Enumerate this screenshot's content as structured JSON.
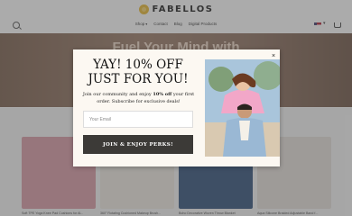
{
  "header": {
    "brand": "FABELLOS",
    "nav": [
      {
        "label": "Shop",
        "has_caret": true
      },
      {
        "label": "Contact",
        "has_caret": false
      },
      {
        "label": "Blog",
        "has_caret": false
      },
      {
        "label": "Digital Products",
        "has_caret": false
      }
    ]
  },
  "hero": {
    "title": "Fuel Your Mind with"
  },
  "products": [
    {
      "title": "Soft TPE Yoga Knee Pad Cushions for Al...",
      "color": "#d99aa6"
    },
    {
      "title": "360° Rotating Cushioned Makeup Brush...",
      "color": "#efeae3"
    },
    {
      "title": "Boho Decorative Woven Throw Blanket",
      "color": "#2f4f7a"
    },
    {
      "title": "Aqua Silicone Braided Adjustable Band f...",
      "color": "#e7e1da"
    }
  ],
  "popup": {
    "title_line1": "YAY! 10% OFF",
    "title_line2": "JUST FOR YOU!",
    "subtitle_before": "Join our community and enjoy ",
    "subtitle_bold": "10% off",
    "subtitle_after": " your first order. Subscribe for exclusive deals!",
    "email_placeholder": "Your Email",
    "email_value": "",
    "cta_label": "JOIN & ENJOY PERKS!",
    "close_glyph": "×"
  },
  "colors": {
    "cta_bg": "#3c3a37",
    "modal_bg": "#fcf8f2",
    "overlay": "rgba(80,80,80,0.48)"
  }
}
